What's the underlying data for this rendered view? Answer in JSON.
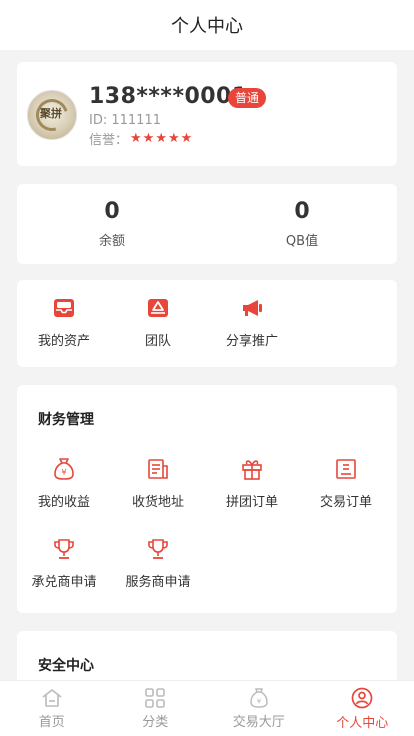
{
  "header": {
    "title": "个人中心"
  },
  "profile": {
    "phone": "138****0001",
    "level": "普通",
    "uid": "ID: 111111",
    "credit_label": "信誉：",
    "stars": "★★★★★",
    "avatar_text": "聚拼"
  },
  "balance": [
    {
      "value": "0",
      "label": "余额"
    },
    {
      "value": "0",
      "label": "QB值"
    }
  ],
  "quick": [
    {
      "label": "我的资产",
      "icon": "inbox-icon"
    },
    {
      "label": "团队",
      "icon": "team-icon"
    },
    {
      "label": "分享推广",
      "icon": "megaphone-icon"
    }
  ],
  "finance": {
    "title": "财务管理",
    "items": [
      {
        "label": "我的收益",
        "icon": "money-bag-icon"
      },
      {
        "label": "收货地址",
        "icon": "address-icon"
      },
      {
        "label": "拼团订单",
        "icon": "gift-icon"
      },
      {
        "label": "交易订单",
        "icon": "order-icon"
      },
      {
        "label": "承兑商申请",
        "icon": "trophy-icon"
      },
      {
        "label": "服务商申请",
        "icon": "trophy-icon"
      }
    ]
  },
  "security": {
    "title": "安全中心"
  },
  "tabbar": [
    {
      "label": "首页",
      "icon": "home-icon",
      "active": false
    },
    {
      "label": "分类",
      "icon": "grid-icon",
      "active": false
    },
    {
      "label": "交易大厅",
      "icon": "bag-icon",
      "active": false
    },
    {
      "label": "个人中心",
      "icon": "user-icon",
      "active": true
    }
  ],
  "colors": {
    "accent": "#e8463a",
    "muted": "#999999",
    "background": "#f3f3f3"
  }
}
